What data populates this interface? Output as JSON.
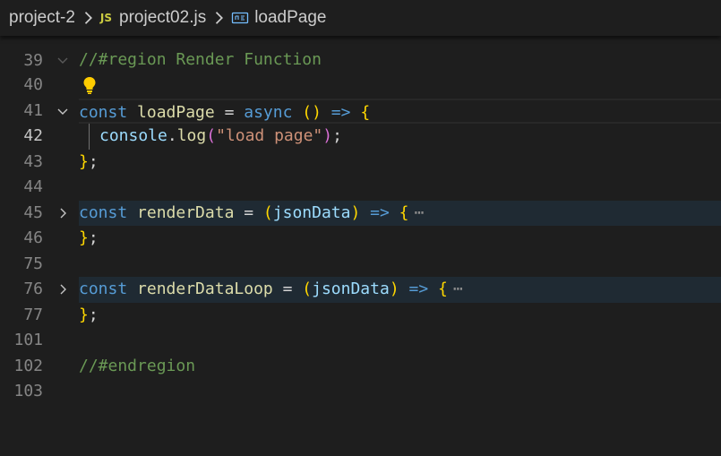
{
  "breadcrumb": {
    "folder": "project-2",
    "file_icon": "JS",
    "file": "project02.js",
    "symbol": "loadPage"
  },
  "lines": [
    {
      "num": "39",
      "text": ""
    },
    {
      "num": "40",
      "text": "//#region Render Function"
    },
    {
      "num": "41",
      "text": ""
    },
    {
      "num": "42",
      "t1": "const",
      "t2": "loadPage",
      "t3": " = ",
      "t4": "async",
      "t5": " ",
      "t6": "()",
      "t7": " => ",
      "t8": "{"
    },
    {
      "num": "43",
      "t1": "console",
      "t2": ".",
      "t3": "log",
      "t4": "(",
      "t5": "\"load page\"",
      "t6": ")",
      "t7": ";"
    },
    {
      "num": "44",
      "t1": "}",
      "t2": ";"
    },
    {
      "num": "45",
      "text": ""
    },
    {
      "num": "46",
      "t1": "const",
      "t2": "renderData",
      "t3": " = ",
      "t4": "(",
      "t5": "jsonData",
      "t6": ")",
      "t7": " => ",
      "t8": "{",
      "t9": "⋯"
    },
    {
      "num": "75",
      "t1": "}",
      "t2": ";"
    },
    {
      "num": "76",
      "text": ""
    },
    {
      "num": "77",
      "t1": "const",
      "t2": "renderDataLoop",
      "t3": " = ",
      "t4": "(",
      "t5": "jsonData",
      "t6": ")",
      "t7": " => ",
      "t8": "{",
      "t9": "⋯"
    },
    {
      "num": "101",
      "t1": "}",
      "t2": ";"
    },
    {
      "num": "102",
      "text": ""
    },
    {
      "num": "103",
      "text": "//#endregion"
    }
  ],
  "colors": {
    "background": "#1e1e1e",
    "keyword": "#569cd6",
    "function": "#dcdcaa",
    "variable": "#9cdcfe",
    "string": "#ce9178",
    "comment": "#6a9955",
    "bracket": "#ffd700",
    "lightbulb": "#ffcc00"
  }
}
